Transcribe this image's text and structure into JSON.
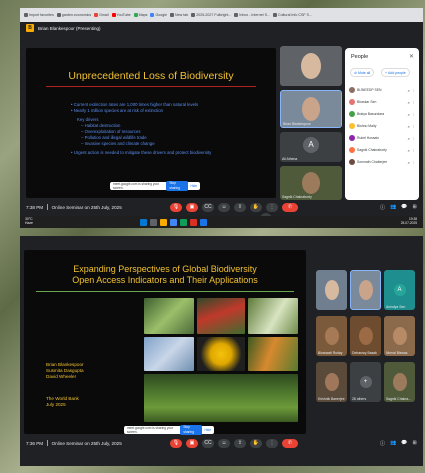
{
  "screen1": {
    "bookmarks": [
      "Import favorites",
      "garden.economics",
      "Gmail",
      "YouTube",
      "Maps",
      "Google",
      "New tab",
      "2025-2027 Fulbright...",
      "Inbox - Internet S...",
      "Cultural Info CSF S..."
    ],
    "meeting_title": "Brian Blankespoor (Presenting)",
    "slide": {
      "title": "Unprecedented Loss of Biodiversity",
      "bullets": [
        "Current extinction rates are 1,000 times higher than natural levels",
        "Nearly 1 million species are at risk of extinction"
      ],
      "drivers_heading": "Key drivers",
      "drivers": [
        "Habitat destruction",
        "Overexploitation of resources",
        "Pollution and illegal wildlife trade",
        "Invasive species and climate change"
      ],
      "closing_bullet": "Urgent action is needed to mitigate these drivers and protect biodiversity"
    },
    "presenting_bar": {
      "text": "meet.google.com is sharing your screen.",
      "stop_label": "Stop sharing",
      "hide_label": "Hide"
    },
    "tiles": [
      {
        "name": ""
      },
      {
        "name": "Brian Blankespoor"
      },
      {
        "name": "Ali Athena"
      },
      {
        "name": "Sagnik Chakraborty"
      }
    ],
    "people_panel": {
      "title": "People",
      "mute_all": "Mute all",
      "add_people": "Add people",
      "participants": [
        {
          "name": "BIJNEEDP SEN",
          "color": "#8d6e63"
        },
        {
          "name": "Bhaskar Sen",
          "color": "#e57373"
        },
        {
          "name": "Bratya Basundara",
          "color": "#43a047"
        },
        {
          "name": "Bishnu Maity",
          "color": "#fbc02d"
        },
        {
          "name": "Rubel Hossain",
          "color": "#8e24aa"
        },
        {
          "name": "Sagnik Chakraborty",
          "color": "#ff7043"
        },
        {
          "name": "Somnath Chatterjee",
          "color": "#6d4c41"
        }
      ]
    },
    "bottom_bar": {
      "time": "7:38 PM",
      "meeting_name": "Online Seminar on 25th July, 2025"
    },
    "taskbar": {
      "temp": "30°C",
      "weather": "Haze",
      "clock_time": "19:38",
      "clock_date": "25-07-2025"
    }
  },
  "screen2": {
    "slide": {
      "title_line1": "Expanding Perspectives of Global Biodiversity",
      "title_line2": "Open Access Indicators and Their Applications",
      "authors": [
        "Brian Blankespoor",
        "Susmita Dasgupta",
        "David Wheeler"
      ],
      "org_line1": "The World Bank",
      "org_line2": "July 2025"
    },
    "presenting_bar": {
      "text": "meet.google.com is sharing your screen.",
      "stop_label": "Stop sharing",
      "hide_label": "Hide"
    },
    "tiles": [
      {
        "name": ""
      },
      {
        "name": ""
      },
      {
        "name": "Anindya Sen"
      },
      {
        "name": "Bhaswati Roday"
      },
      {
        "name": "Debasray Basak"
      },
      {
        "name": "Nirmal Biswas"
      },
      {
        "name": "Krishnik Banerjee"
      },
      {
        "name": "28 others"
      },
      {
        "name": "Sagnik Chakra..."
      }
    ],
    "bottom_bar": {
      "time": "7:36 PM",
      "meeting_name": "Online Seminar on 25th July, 2025"
    }
  }
}
